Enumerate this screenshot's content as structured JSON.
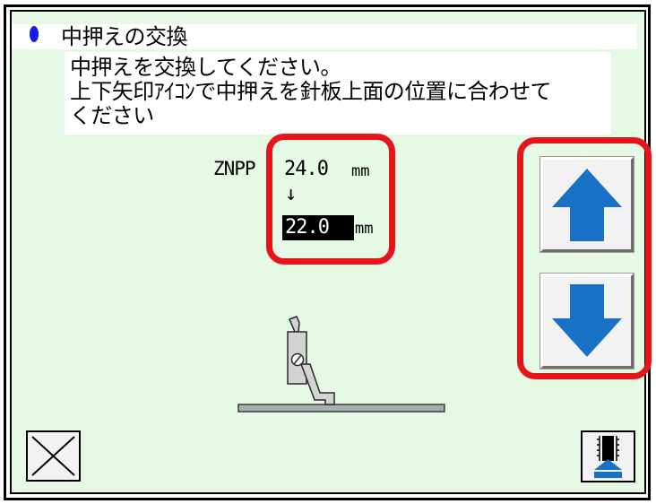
{
  "header": {
    "title": "中押えの交換"
  },
  "message": {
    "line1": "中押えを交換してください。",
    "line2": "上下矢印ｱｲｺﾝで中押えを針板上面の位置に合わせて",
    "line3": "ください"
  },
  "setting": {
    "label": "ZNPP",
    "current_value": "24.0",
    "current_unit": "mm",
    "change_arrow": "↓",
    "new_value": "22.0",
    "new_unit": "mm"
  },
  "buttons": {
    "up": {
      "icon": "arrow-up-icon"
    },
    "down": {
      "icon": "arrow-down-icon"
    },
    "close": {
      "icon": "close-icon"
    },
    "confirm": {
      "icon": "presser-up-icon"
    }
  },
  "colors": {
    "background": "#e6f9e4",
    "highlight_red": "#e8141c",
    "arrow_blue": "#1871c4",
    "title_dot": "#1a1aee"
  }
}
